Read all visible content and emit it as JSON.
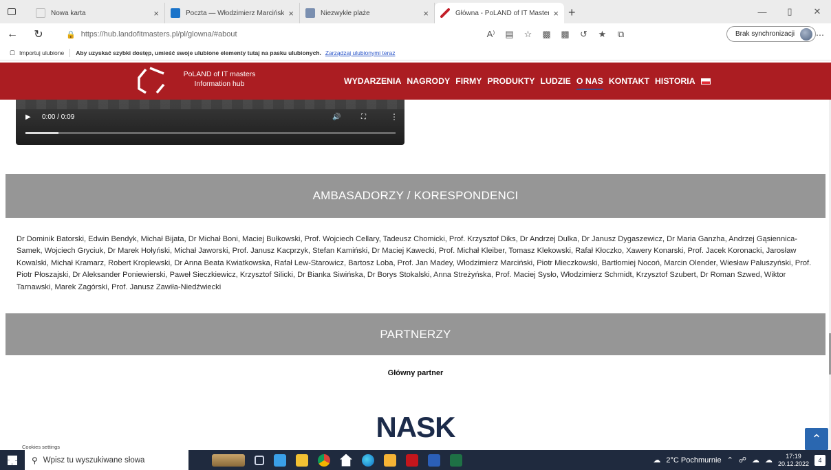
{
  "browser": {
    "tabs": [
      {
        "label": "Nowa karta",
        "favicon_color": "#cfcfcf",
        "active": false
      },
      {
        "label": "Poczta — Włodzimierz Marciński",
        "favicon_color": "#1a73c9",
        "active": false
      },
      {
        "label": "Niezwykłe plaże",
        "favicon_color": "#7a8fb0",
        "active": false
      },
      {
        "label": "Główna - PoLAND of IT Masters",
        "favicon_color": "#c3202a",
        "active": true
      }
    ],
    "close_glyph": "×",
    "new_tab_glyph": "+",
    "url": "https://hub.landofitmasters.pl/pl/glowna/#about",
    "sync_label": "Brak synchronizacji",
    "favorites_bar": {
      "import_label": "Importuj ulubione",
      "hint": "Aby uzyskać szybki dostęp, umieść swoje ulubione elementy tutaj na pasku ulubionych.",
      "manage_link": "Zarządzaj ulubionymi teraz"
    }
  },
  "site": {
    "logo_line1": "PoLAND of IT masters",
    "logo_line2": "Information hub",
    "nav": [
      {
        "label": "WYDARZENIA",
        "current": false
      },
      {
        "label": "NAGRODY",
        "current": false
      },
      {
        "label": "FIRMY",
        "current": false
      },
      {
        "label": "PRODUKTY",
        "current": false
      },
      {
        "label": "LUDZIE",
        "current": false
      },
      {
        "label": "O NAS",
        "current": true
      },
      {
        "label": "KONTAKT",
        "current": false
      },
      {
        "label": "HISTORIA",
        "current": false
      }
    ],
    "brand_color": "#ab1d22"
  },
  "video": {
    "time": "0:00 / 0:09",
    "progress": 0.09
  },
  "ambassadors": {
    "heading": "AMBASADORZY / KORESPONDENCI",
    "names": "Dr Dominik Batorski, Edwin Bendyk, Michał Bijata, Dr Michał Boni, Maciej Bułkowski, Prof. Wojciech Cellary, Tadeusz Chomicki, Prof. Krzysztof Diks, Dr Andrzej Dulka, Dr Janusz Dygaszewicz, Dr Maria Ganzha, Andrzej Gąsiennica-Samek, Wojciech Gryciuk, Dr Marek Hołyński, Michał Jaworski, Prof. Janusz Kacprzyk, Stefan Kamiński, Dr Maciej Kawecki, Prof. Michał Kleiber, Tomasz Klekowski, Rafał Kłoczko, Xawery Konarski, Prof. Jacek Koronacki, Jarosław Kowalski, Michał Kramarz, Robert Kroplewski, Dr Anna Beata Kwiatkowska, Rafał Lew-Starowicz, Bartosz Loba, Prof. Jan Madey, Włodzimierz Marciński, Piotr Mieczkowski, Bartłomiej Nocoń, Marcin Olender, Wiesław Paluszyński, Prof. Piotr Płoszajski, Dr Aleksander Poniewierski, Paweł Sieczkiewicz, Krzysztof Silicki, Dr Bianka Siwińska, Dr Borys Stokalski, Anna Streżyńska, Prof. Maciej Sysło, Włodzimierz Schmidt, Krzysztof Szubert, Dr Roman Szwed, Wiktor Tarnawski, Marek Zagórski, Prof. Janusz Zawiła-Niedźwiecki"
  },
  "partners": {
    "heading": "PARTNERZY",
    "main_partner_label": "Główny partner",
    "main_partner_logo": "NASK"
  },
  "cookies_label": "Cookies settings",
  "taskbar": {
    "search_placeholder": "Wpisz tu wyszukiwane słowa",
    "weather": "2°C Pochmurnie",
    "time": "17:19",
    "date": "20.12.2022",
    "notification_count": "4"
  }
}
